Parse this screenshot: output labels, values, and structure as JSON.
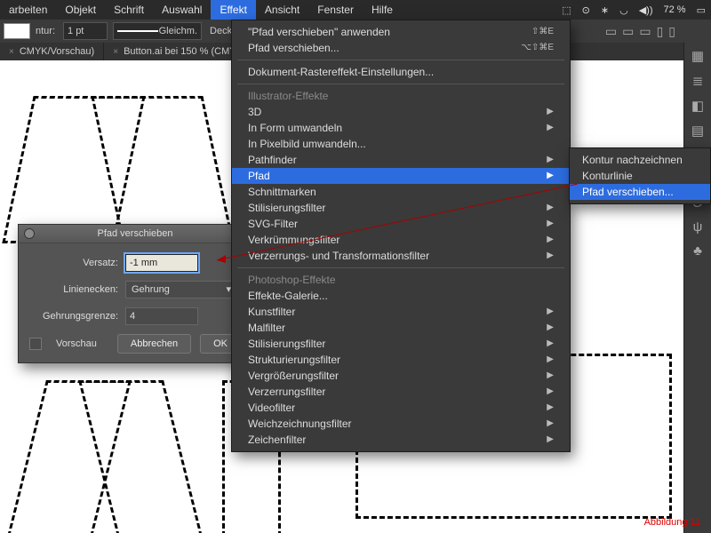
{
  "menubar": {
    "items": [
      "arbeiten",
      "Objekt",
      "Schrift",
      "Auswahl",
      "Effekt",
      "Ansicht",
      "Fenster",
      "Hilfe"
    ],
    "active_index": 4,
    "sys": {
      "battery": "72 %",
      "wifi": "on"
    }
  },
  "toolbar": {
    "kontur_label": "ntur:",
    "stroke_value": "1 pt",
    "stroke_style": "Gleichm.",
    "deck_label": "Deck"
  },
  "tabs": {
    "items": [
      {
        "label": "CMYK/Vorschau)",
        "closeable": true
      },
      {
        "label": "Button.ai bei 150 % (CMYK",
        "closeable": true
      }
    ]
  },
  "effekt_menu": {
    "apply": {
      "label": "\"Pfad verschieben\" anwenden",
      "shortcut": "⇧⌘E"
    },
    "reapply": {
      "label": "Pfad verschieben...",
      "shortcut": "⌥⇧⌘E"
    },
    "raster": {
      "label": "Dokument-Rastereffekt-Einstellungen..."
    },
    "header1": "Illustrator-Effekte",
    "ai_items": [
      {
        "label": "3D",
        "arrow": true
      },
      {
        "label": "In Form umwandeln",
        "arrow": true
      },
      {
        "label": "In Pixelbild umwandeln..."
      },
      {
        "label": "Pathfinder",
        "arrow": true
      },
      {
        "label": "Pfad",
        "arrow": true,
        "selected": true
      },
      {
        "label": "Schnittmarken"
      },
      {
        "label": "Stilisierungsfilter",
        "arrow": true
      },
      {
        "label": "SVG-Filter",
        "arrow": true
      },
      {
        "label": "Verkrümmungsfilter",
        "arrow": true
      },
      {
        "label": "Verzerrungs- und Transformationsfilter",
        "arrow": true
      }
    ],
    "header2": "Photoshop-Effekte",
    "ps_items": [
      {
        "label": "Effekte-Galerie..."
      },
      {
        "label": "Kunstfilter",
        "arrow": true
      },
      {
        "label": "Malfilter",
        "arrow": true
      },
      {
        "label": "Stilisierungsfilter",
        "arrow": true
      },
      {
        "label": "Strukturierungsfilter",
        "arrow": true
      },
      {
        "label": "Vergrößerungsfilter",
        "arrow": true
      },
      {
        "label": "Verzerrungsfilter",
        "arrow": true
      },
      {
        "label": "Videofilter",
        "arrow": true
      },
      {
        "label": "Weichzeichnungsfilter",
        "arrow": true
      },
      {
        "label": "Zeichenfilter",
        "arrow": true
      }
    ]
  },
  "pfad_submenu": {
    "items": [
      {
        "label": "Kontur nachzeichnen"
      },
      {
        "label": "Konturlinie"
      },
      {
        "label": "Pfad verschieben...",
        "selected": true
      }
    ]
  },
  "dialog": {
    "title": "Pfad verschieben",
    "versatz_label": "Versatz:",
    "versatz_value": "-1 mm",
    "linienecken_label": "Linienecken:",
    "linienecken_value": "Gehrung",
    "gehrungsgrenze_label": "Gehrungsgrenze:",
    "gehrungsgrenze_value": "4",
    "vorschau_label": "Vorschau",
    "cancel": "Abbrechen",
    "ok": "OK"
  },
  "caption": "Abbildung 11",
  "right_panel_icons": [
    "grid-icon",
    "layers-icon",
    "color-icon",
    "swatches-icon",
    "paragraph-icon",
    "type-icon",
    "glyph-icon",
    "link-icon",
    "symbols-icon"
  ]
}
